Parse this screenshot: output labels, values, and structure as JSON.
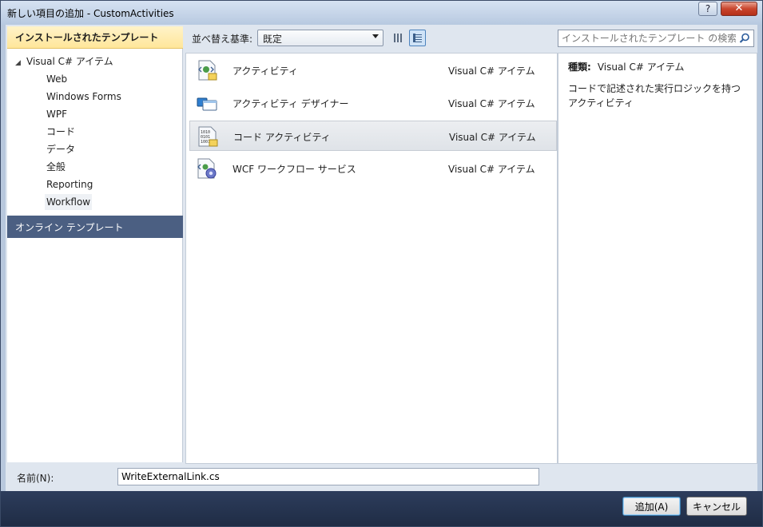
{
  "window": {
    "title": "新しい項目の追加 - CustomActivities",
    "help_label": "?",
    "close_label": "✕"
  },
  "left_panel": {
    "installed_header": "インストールされたテンプレート",
    "tree_root": "Visual C# アイテム",
    "tree_items": [
      "Web",
      "Windows Forms",
      "WPF",
      "コード",
      "データ",
      "全般",
      "Reporting",
      "Workflow"
    ],
    "selected_item": "Workflow",
    "online_header": "オンライン テンプレート"
  },
  "toolbar": {
    "sort_label": "並べ替え基準:",
    "sort_value": "既定"
  },
  "templates": [
    {
      "name": "アクティビティ",
      "type": "Visual C# アイテム",
      "icon": "activity-icon"
    },
    {
      "name": "アクティビティ デザイナー",
      "type": "Visual C# アイテム",
      "icon": "activity-designer-icon"
    },
    {
      "name": "コード アクティビティ",
      "type": "Visual C# アイテム",
      "icon": "code-activity-icon",
      "selected": true
    },
    {
      "name": "WCF ワークフロー サービス",
      "type": "Visual C# アイテム",
      "icon": "wcf-workflow-icon"
    }
  ],
  "search": {
    "placeholder": "インストールされたテンプレート の検索"
  },
  "details": {
    "type_label": "種類:",
    "type_value": "Visual C# アイテム",
    "description": "コードで記述された実行ロジックを持つアクティビティ"
  },
  "name_field": {
    "label": "名前(N):",
    "value": "WriteExternalLink.cs"
  },
  "buttons": {
    "add": "追加(A)",
    "cancel": "キャンセル"
  }
}
